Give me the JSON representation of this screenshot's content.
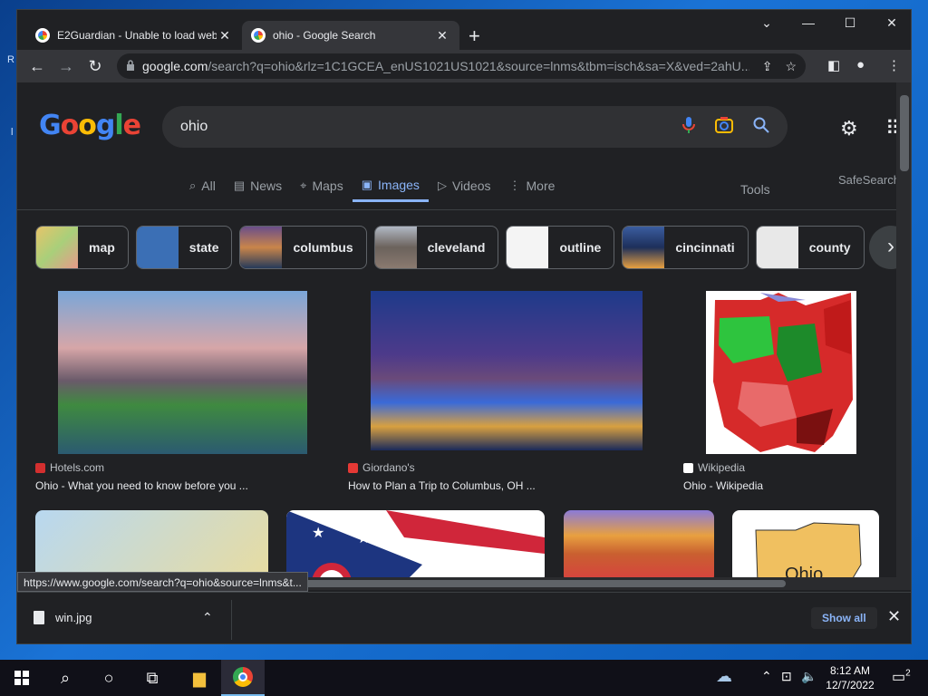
{
  "desktop": {
    "glyph_r": "R",
    "glyph_l": "l"
  },
  "tabs": [
    {
      "title": "E2Guardian - Unable to load web page",
      "close": "✕"
    },
    {
      "title": "ohio - Google Search",
      "close": "✕"
    }
  ],
  "newtab": "+",
  "window_controls": {
    "dropdown": "⌄",
    "minimize": "—",
    "maximize": "☐",
    "close": "✕"
  },
  "toolbar": {
    "back": "←",
    "forward": "→",
    "reload": "↻",
    "url_host": "google.com",
    "url_path": "/search?q=ohio&rlz=1C1GCEA_enUS1021US1021&source=lnms&tbm=isch&sa=X&ved=2ahU..."
  },
  "google": {
    "logo": [
      "G",
      "o",
      "o",
      "g",
      "l",
      "e"
    ],
    "query": "ohio",
    "nav": [
      {
        "label": "All",
        "icon": "search-icon",
        "glyph": "⌕"
      },
      {
        "label": "News",
        "icon": "news-icon",
        "glyph": "▤"
      },
      {
        "label": "Maps",
        "icon": "pin-icon",
        "glyph": "⌖"
      },
      {
        "label": "Images",
        "icon": "image-icon",
        "glyph": "▣",
        "active": true
      },
      {
        "label": "Videos",
        "icon": "play-icon",
        "glyph": "▷"
      },
      {
        "label": "More",
        "icon": "more-icon",
        "glyph": "⋮"
      }
    ],
    "tools": "Tools",
    "safesearch": "SafeSearch",
    "chips": [
      {
        "label": "map",
        "color": "#d9c27a"
      },
      {
        "label": "state",
        "color": "#3b6fb5"
      },
      {
        "label": "columbus",
        "color": "#c9854a"
      },
      {
        "label": "cleveland",
        "color": "#8a7a70"
      },
      {
        "label": "outline",
        "color": "#f4f4f4"
      },
      {
        "label": "cincinnati",
        "color": "#2e4f8a"
      },
      {
        "label": "county",
        "color": "#e8e8e8"
      }
    ],
    "results": [
      {
        "source": "Hotels.com",
        "caption": "Ohio - What you need to know before you ...",
        "fav_color": "#d32f2f"
      },
      {
        "source": "Giordano's",
        "caption": "How to Plan a Trip to Columbus, OH ...",
        "fav_color": "#e53935"
      },
      {
        "source": "Wikipedia",
        "caption": "Ohio - Wikipedia",
        "fav_color": "#ffffff"
      }
    ],
    "bottom_row_label": "Ohio"
  },
  "status_url": "https://www.google.com/search?q=ohio&source=lnms&t...",
  "download": {
    "file": "win.jpg",
    "show_all": "Show all",
    "close": "✕"
  },
  "taskbar": {
    "time": "8:12 AM",
    "date": "12/7/2022",
    "notification_count": "2"
  }
}
